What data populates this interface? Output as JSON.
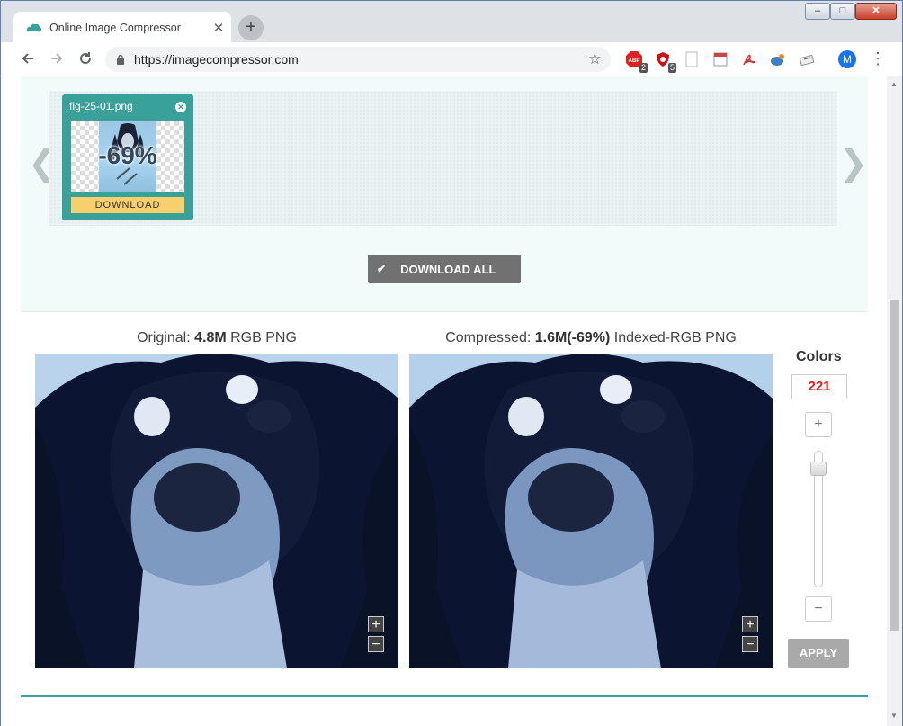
{
  "browser": {
    "tab_title": "Online Image Compressor",
    "tab_close": "✕",
    "new_tab": "+",
    "url": "https://imagecompressor.com",
    "ext_badges": [
      "2",
      "5"
    ],
    "avatar_letter": "M",
    "win_minimize": "–",
    "win_maximize": "□",
    "win_close": "✕"
  },
  "strip": {
    "prev_arrow": "❮",
    "next_arrow": "❯",
    "file_name": "fig-25-01.png",
    "card_close": "✕",
    "reduction": "-69%",
    "download_label": "DOWNLOAD"
  },
  "download_all_label": "DOWNLOAD ALL",
  "compare": {
    "original_prefix": "Original:",
    "original_size": "4.8M",
    "original_format": "RGB PNG",
    "compressed_prefix": "Compressed:",
    "compressed_size": "1.6M(-69%)",
    "compressed_format": "Indexed-RGB PNG",
    "zoom_in": "+",
    "zoom_out": "−"
  },
  "controls": {
    "colors_title": "Colors",
    "colors_value": "221",
    "plus": "+",
    "minus": "−",
    "apply_label": "APPLY",
    "slider_position": 0.08
  },
  "colors": {
    "teal": "#3aa19a",
    "download_yellow": "#f7cf6d",
    "colors_red": "#e21a1a"
  }
}
